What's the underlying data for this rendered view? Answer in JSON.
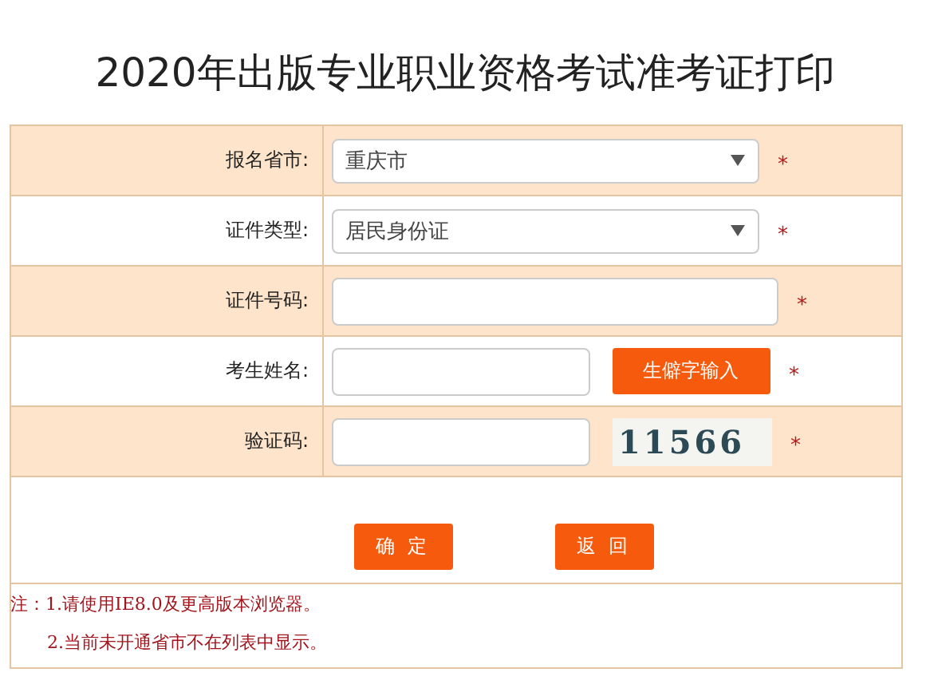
{
  "title": "2020年出版专业职业资格考试准考证打印",
  "rows": [
    {
      "kind": "select",
      "label": "报名省市:",
      "value": "重庆市",
      "required_mark": "*"
    },
    {
      "kind": "select",
      "label": "证件类型:",
      "value": "居民身份证",
      "required_mark": "*"
    },
    {
      "kind": "input",
      "label": "证件号码:",
      "required_mark": "*"
    },
    {
      "kind": "input_button",
      "label": "考生姓名:",
      "button": "生僻字输入",
      "required_mark": "*"
    },
    {
      "kind": "captcha",
      "label": "验证码:",
      "captcha": "11566",
      "required_mark": "*"
    }
  ],
  "buttons": [
    "确 定",
    "返 回"
  ],
  "notes": [
    "注：1.请使用IE8.0及更高版本浏览器。",
    "2.当前未开通省市不在列表中显示。"
  ]
}
